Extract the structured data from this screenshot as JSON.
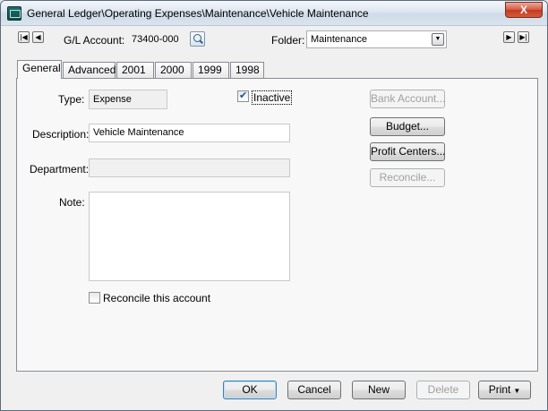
{
  "window": {
    "title": "General Ledger\\Operating Expenses\\Maintenance\\Vehicle Maintenance",
    "close_label": "X"
  },
  "toolbar": {
    "first_label": "|◀",
    "prev_label": "◀",
    "next_label": "▶",
    "last_label": "▶|",
    "gl_account_label": "G/L Account:",
    "gl_account_value": "73400-000",
    "folder_label": "Folder:",
    "folder_value": "Maintenance",
    "folder_arrow": "▼"
  },
  "tabs": [
    {
      "label": "General",
      "active": true
    },
    {
      "label": "Advanced"
    },
    {
      "label": "2001"
    },
    {
      "label": "2000"
    },
    {
      "label": "1999"
    },
    {
      "label": "1998"
    }
  ],
  "general": {
    "type_label": "Type:",
    "type_value": "Expense",
    "inactive_label": "Inactive",
    "inactive_checked": true,
    "description_label": "Description:",
    "description_value": "Vehicle Maintenance",
    "department_label": "Department:",
    "department_value": "",
    "note_label": "Note:",
    "note_value": "",
    "reconcile_label": "Reconcile this account",
    "reconcile_checked": false
  },
  "side_buttons": {
    "bank_account": "Bank Account...",
    "budget": "Budget...",
    "profit_centers": "Profit Centers...",
    "reconcile": "Reconcile..."
  },
  "footer": {
    "ok": "OK",
    "cancel": "Cancel",
    "new": "New",
    "delete": "Delete",
    "print": "Print",
    "print_arrow": "▼"
  }
}
